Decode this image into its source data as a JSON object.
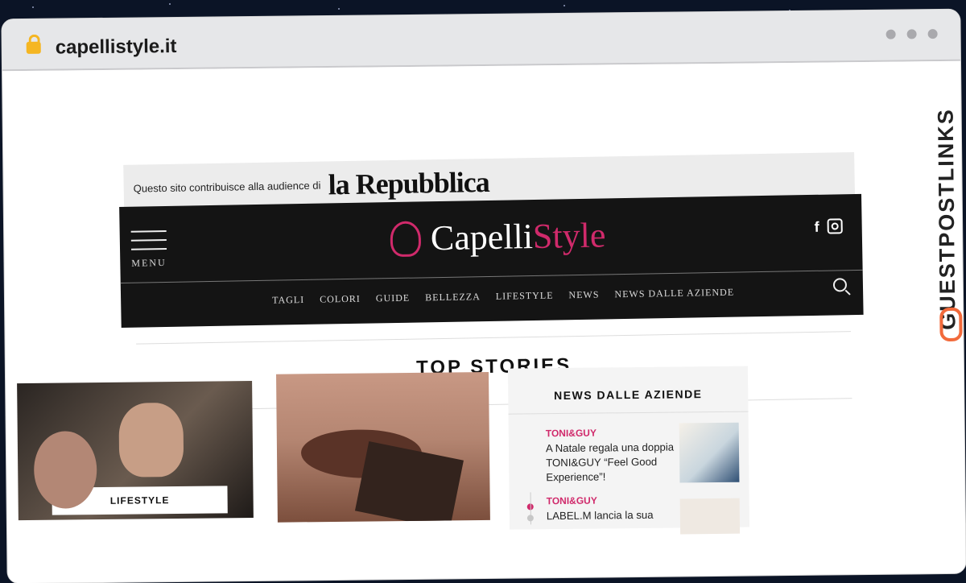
{
  "browser": {
    "url": "capellistyle.it"
  },
  "watermark": {
    "text": "GUESTPOSTLINKS",
    "accent": "#f26a3b"
  },
  "site": {
    "partner": {
      "intro": "Questo sito contribuisce alla audience di",
      "logo": "la Repubblica"
    },
    "header": {
      "menu_label": "MENU",
      "logo_primary": "Capelli",
      "logo_secondary": "Style",
      "social_f": "f",
      "nav": [
        "TAGLI",
        "COLORI",
        "GUIDE",
        "BELLEZZA",
        "LIFESTYLE",
        "NEWS",
        "NEWS DALLE AZIENDE"
      ],
      "accent_color": "#d02a6b"
    },
    "top_stories": {
      "title": "TOP STORIES"
    },
    "card1": {
      "tag": "LIFESTYLE"
    },
    "sidebar": {
      "title": "NEWS DALLE AZIENDE",
      "items": [
        {
          "brand": "TONI&GUY",
          "text": "A Natale regala una doppia TONI&GUY “Feel Good Experience”!"
        },
        {
          "brand": "TONI&GUY",
          "text": "LABEL.M lancia la sua"
        }
      ]
    }
  }
}
